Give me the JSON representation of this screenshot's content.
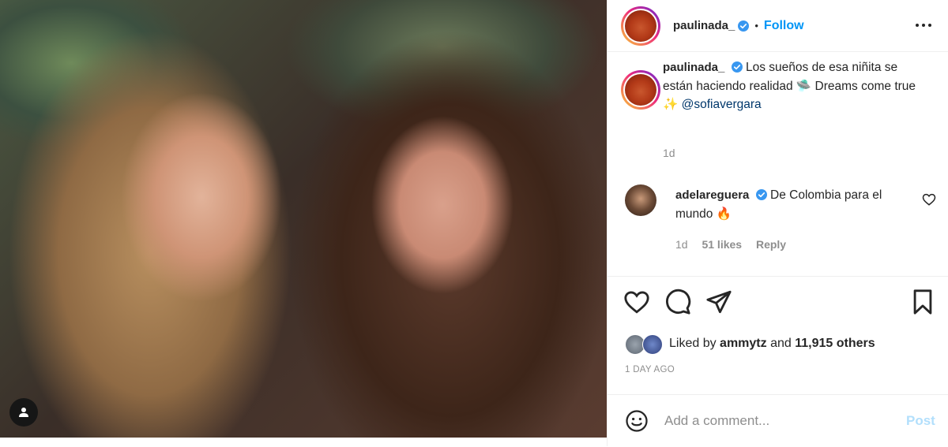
{
  "post_owner": {
    "username": "paulinada_",
    "follow_label": "Follow",
    "separator": "•"
  },
  "caption": {
    "username": "paulinada_",
    "text_part1": "Los sueños de esa niñita se están haciendo realidad",
    "emoji1": "🛸",
    "text_part2": "Dreams come true",
    "emoji2": "✨",
    "mention": "@sofiavergara",
    "age": "1d"
  },
  "comment": {
    "username": "adelareguera",
    "text": "De Colombia para el mundo",
    "emoji": "🔥",
    "age": "1d",
    "likes": "51 likes",
    "reply_label": "Reply"
  },
  "likes": {
    "prefix": "Liked by",
    "user": "ammytz",
    "and": "and",
    "count": "11,915 others"
  },
  "timestamp": "1 DAY AGO",
  "add_comment": {
    "placeholder": "Add a comment...",
    "post_label": "Post"
  },
  "colors": {
    "link_blue": "#0095f6",
    "verified_blue": "#3897f0",
    "muted": "#8e8e8e",
    "post_disabled": "#b2dffc"
  },
  "icons": [
    "user-tag-icon",
    "verified-icon",
    "more-options-icon",
    "heart-icon",
    "comment-icon",
    "share-icon",
    "bookmark-icon",
    "emoji-icon"
  ]
}
